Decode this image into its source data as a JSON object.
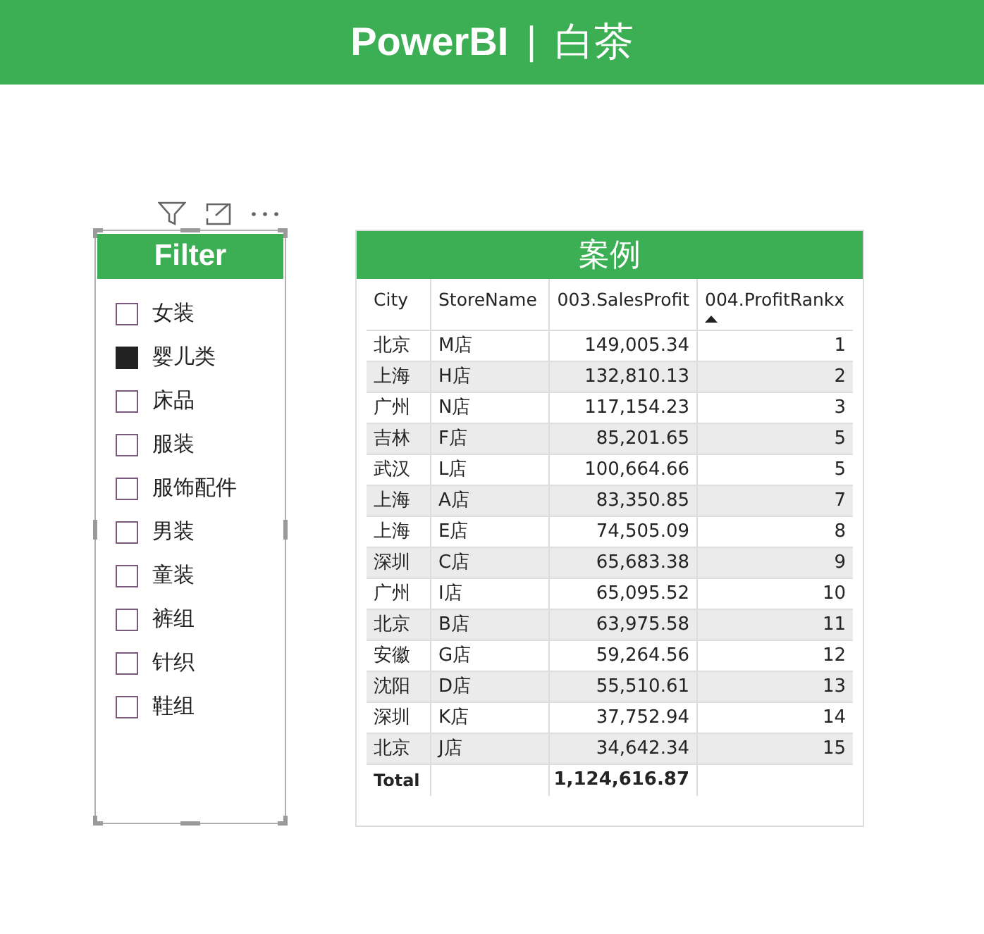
{
  "header": {
    "brand": "PowerBI",
    "separator": "|",
    "subtitle": "白茶"
  },
  "slicer": {
    "title": "Filter",
    "items": [
      {
        "label": "女装",
        "checked": false
      },
      {
        "label": "婴儿类",
        "checked": true
      },
      {
        "label": "床品",
        "checked": false
      },
      {
        "label": "服装",
        "checked": false
      },
      {
        "label": "服饰配件",
        "checked": false
      },
      {
        "label": "男装",
        "checked": false
      },
      {
        "label": "童装",
        "checked": false
      },
      {
        "label": "裤组",
        "checked": false
      },
      {
        "label": "针织",
        "checked": false
      },
      {
        "label": "鞋组",
        "checked": false
      }
    ]
  },
  "table": {
    "title": "案例",
    "columns": [
      {
        "label": "City",
        "sorted": false
      },
      {
        "label": "StoreName",
        "sorted": false
      },
      {
        "label": "003.SalesProfit",
        "sorted": false
      },
      {
        "label": "004.ProfitRankx",
        "sorted": true
      }
    ],
    "rows": [
      [
        "北京",
        "M店",
        "149,005.34",
        "1"
      ],
      [
        "上海",
        "H店",
        "132,810.13",
        "2"
      ],
      [
        "广州",
        "N店",
        "117,154.23",
        "3"
      ],
      [
        "吉林",
        "F店",
        "85,201.65",
        "5"
      ],
      [
        "武汉",
        "L店",
        "100,664.66",
        "5"
      ],
      [
        "上海",
        "A店",
        "83,350.85",
        "7"
      ],
      [
        "上海",
        "E店",
        "74,505.09",
        "8"
      ],
      [
        "深圳",
        "C店",
        "65,683.38",
        "9"
      ],
      [
        "广州",
        "I店",
        "65,095.52",
        "10"
      ],
      [
        "北京",
        "B店",
        "63,975.58",
        "11"
      ],
      [
        "安徽",
        "G店",
        "59,264.56",
        "12"
      ],
      [
        "沈阳",
        "D店",
        "55,510.61",
        "13"
      ],
      [
        "深圳",
        "K店",
        "37,752.94",
        "14"
      ],
      [
        "北京",
        "J店",
        "34,642.34",
        "15"
      ]
    ],
    "total": {
      "label": "Total",
      "value": "1,124,616.87"
    }
  }
}
